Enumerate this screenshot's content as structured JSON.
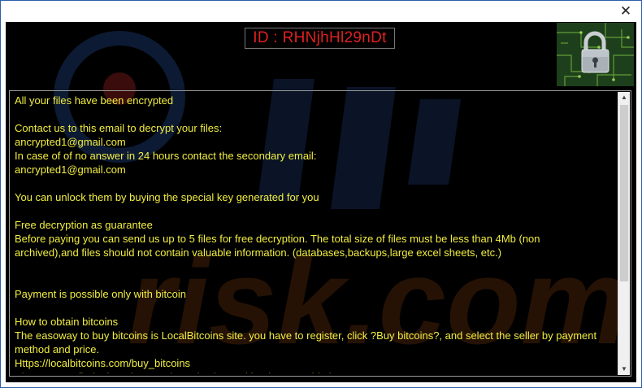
{
  "window": {
    "close_glyph": "✕"
  },
  "header": {
    "id_text": "ID : RHNjhHl29nDt"
  },
  "lock_image": {
    "icon": "padlock-on-circuit-board"
  },
  "message": {
    "lines": [
      "All your files have been encrypted",
      "",
      "Contact us to this email to decrypt your files:",
      "ancrypted1@gmail.com",
      "In case of of no answer in 24 hours contact the secondary email:",
      "ancrypted1@gmail.com",
      "",
      "You can unlock them by buying the special key generated for you",
      "",
      "Free decryption as guarantee",
      "Before paying you can send us up to 5 files for free decryption. The total size of files must be less than 4Mb (non",
      "archived),and files should not contain valuable information. (databases,backups,large excel sheets, etc.)",
      "",
      "",
      "Payment is possible only with bitcoin",
      "",
      "How to obtain bitcoins",
      "The easoway to buy bitcoins is LocalBitcoins site. you have to register, click ?Buy bitcoins?, and select the seller by payment",
      "method and price.",
      "Https://localbitcoins.com/buy_bitcoins",
      "Also you can find other places to buy Bitcoins and beginners guide here:"
    ]
  },
  "scrollbar": {
    "up_glyph": "▲",
    "down_glyph": "▼",
    "position": 0.0
  },
  "watermark": {
    "text": "risk.com"
  },
  "colors": {
    "text": "#f2ee40",
    "id_text": "#e02020",
    "background": "#000000"
  }
}
